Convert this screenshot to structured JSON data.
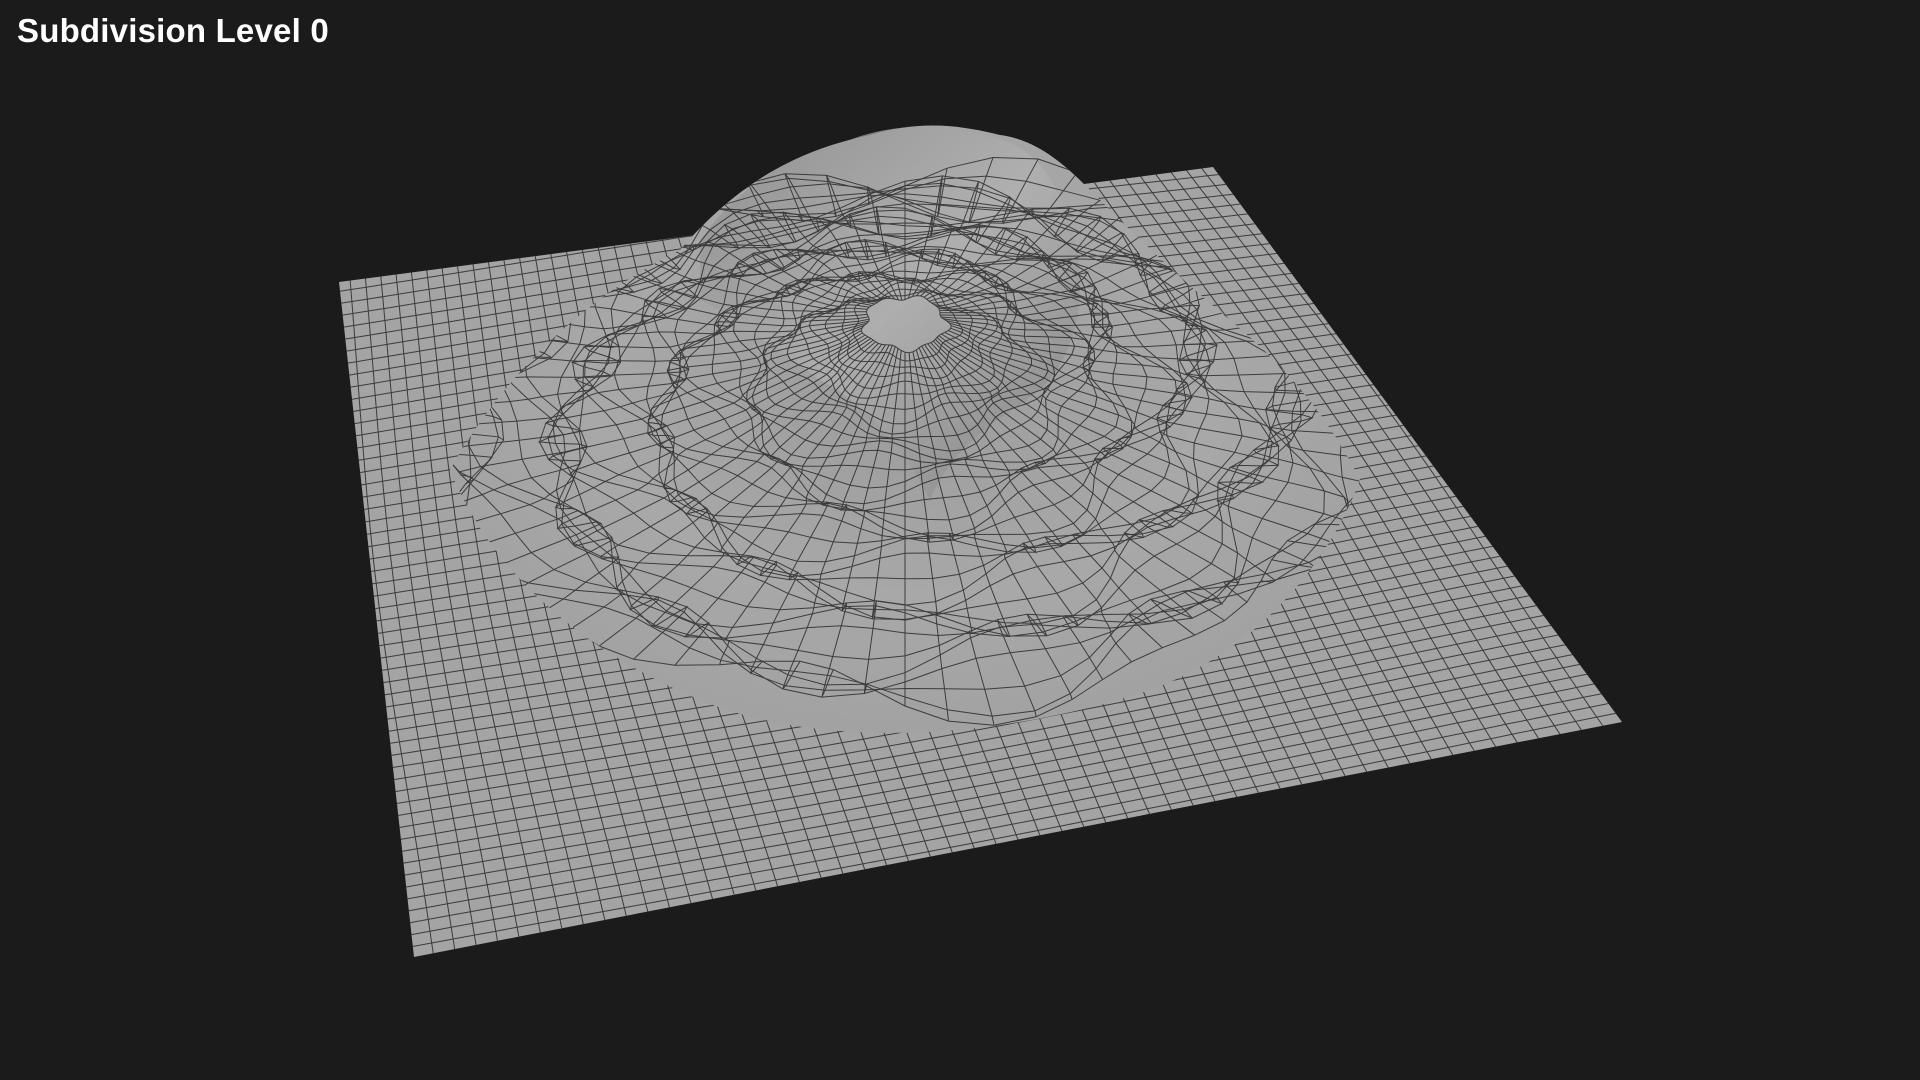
{
  "overlay": {
    "label": "Subdivision Level 0"
  },
  "scene": {
    "background_color": "#1b1b1b",
    "mesh_color": "#a2a2a2",
    "wire_color": "#242424",
    "shading": "grey clay with black quad wireframe",
    "subject": "terrain mountain mesh"
  }
}
